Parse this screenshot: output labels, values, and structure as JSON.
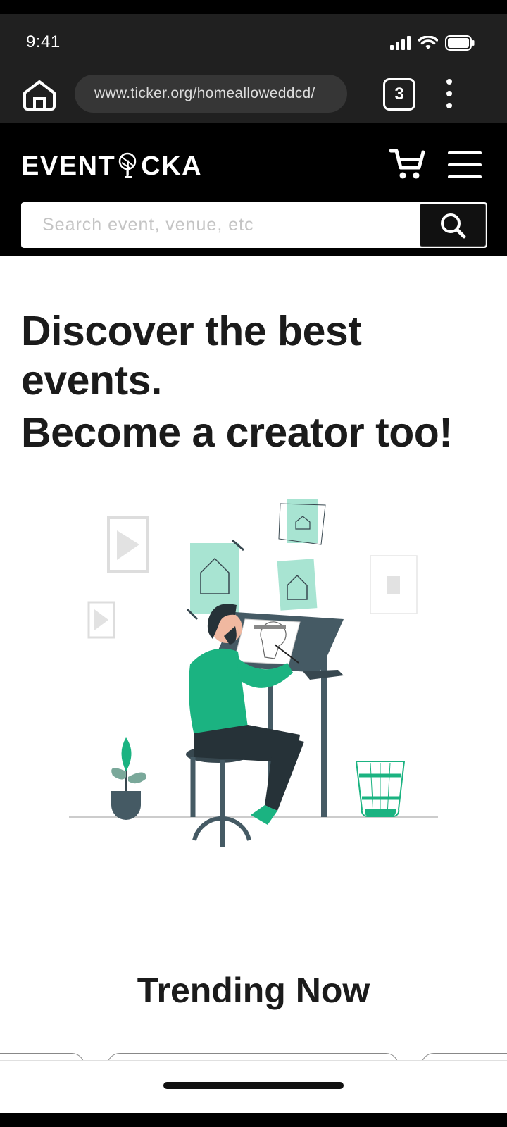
{
  "status_bar": {
    "time": "9:41",
    "icons": [
      "cellular-signal-icon",
      "wifi-icon",
      "battery-icon"
    ]
  },
  "browser": {
    "url": "www.ticker.org/homealloweddcd/",
    "tab_count": "3",
    "icons": [
      "browser-home-icon",
      "more-options-icon"
    ]
  },
  "site_header": {
    "logo_left": "EVENT",
    "logo_mid": "I",
    "logo_right": "CKA",
    "icons": [
      "microphone-logo-icon",
      "cart-icon",
      "hamburger-menu-icon"
    ],
    "search_placeholder": "Search event, venue, etc",
    "search_value": ""
  },
  "hero": {
    "title_line1": "Discover the best events.",
    "title_line2": "Become a creator too!"
  },
  "trending": {
    "title": "Trending Now"
  },
  "colors": {
    "accent": "#1bb381",
    "accent_light": "#a8e4d2",
    "dark_slate": "#37474f",
    "header_bg": "#000000",
    "browser_bg": "#202020"
  }
}
